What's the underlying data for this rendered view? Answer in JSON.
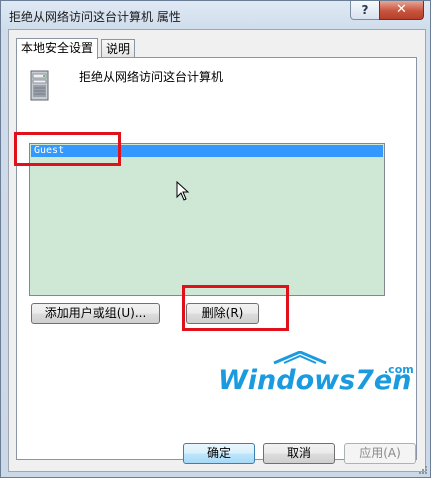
{
  "window": {
    "title": "拒绝从网络访问这台计算机 属性",
    "help_label": "?",
    "close_label": "✕"
  },
  "tabs": [
    {
      "label": "本地安全设置",
      "active": true
    },
    {
      "label": "说明",
      "active": false
    }
  ],
  "policy": {
    "icon": "computer-tower-icon",
    "name": "拒绝从网络访问这台计算机"
  },
  "list": {
    "items": [
      "Guest"
    ],
    "selected_index": 0
  },
  "buttons": {
    "add": "添加用户或组(U)...",
    "remove": "删除(R)",
    "ok": "确定",
    "cancel": "取消",
    "apply": "应用(A)"
  },
  "watermark": {
    "text": "Windows7en",
    "suffix": ".com"
  },
  "colors": {
    "selection": "#3399ff",
    "list_bg": "#cfe8d6",
    "highlight_box": "#e0111b",
    "watermark_blue": "#1a9be0"
  }
}
